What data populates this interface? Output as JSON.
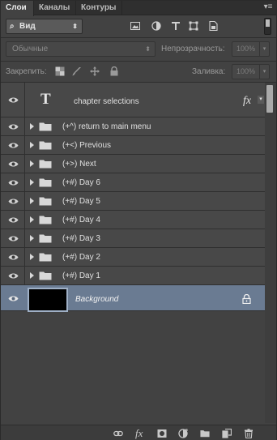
{
  "tabs": [
    {
      "label": "Слои",
      "active": true
    },
    {
      "label": "Каналы",
      "active": false
    },
    {
      "label": "Контуры",
      "active": false
    }
  ],
  "filter": {
    "kind_label": "Вид",
    "icons": [
      "image-filter-icon",
      "adjustment-filter-icon",
      "type-filter-icon",
      "shape-filter-icon",
      "smart-object-filter-icon"
    ]
  },
  "blend": {
    "mode": "Обычные",
    "opacity_label": "Непрозрачность:",
    "opacity_value": "100%"
  },
  "lock": {
    "label": "Закрепить:",
    "fill_label": "Заливка:",
    "fill_value": "100%"
  },
  "layers": [
    {
      "kind": "text",
      "name": "chapter selections",
      "fx": "fx"
    },
    {
      "kind": "group",
      "name": "(+^) return to main menu"
    },
    {
      "kind": "group",
      "name": "(+<) Previous"
    },
    {
      "kind": "group",
      "name": "(+>) Next"
    },
    {
      "kind": "group",
      "name": "(+#) Day 6"
    },
    {
      "kind": "group",
      "name": "(+#) Day 5"
    },
    {
      "kind": "group",
      "name": "(+#) Day 4"
    },
    {
      "kind": "group",
      "name": "(+#) Day 3"
    },
    {
      "kind": "group",
      "name": "(+#) Day 2"
    },
    {
      "kind": "group",
      "name": "(+#) Day 1"
    },
    {
      "kind": "background",
      "name": "Background",
      "selected": true
    }
  ],
  "bottom_bar": {
    "fx_label": "fx",
    "icons": [
      "link-layers-icon",
      "add-style-icon",
      "add-mask-icon",
      "new-adjustment-icon",
      "new-group-icon",
      "new-layer-icon",
      "delete-layer-icon"
    ]
  },
  "colors": {
    "panel": "#424242",
    "row": "#484848",
    "selected_row": "#6a7b92"
  }
}
